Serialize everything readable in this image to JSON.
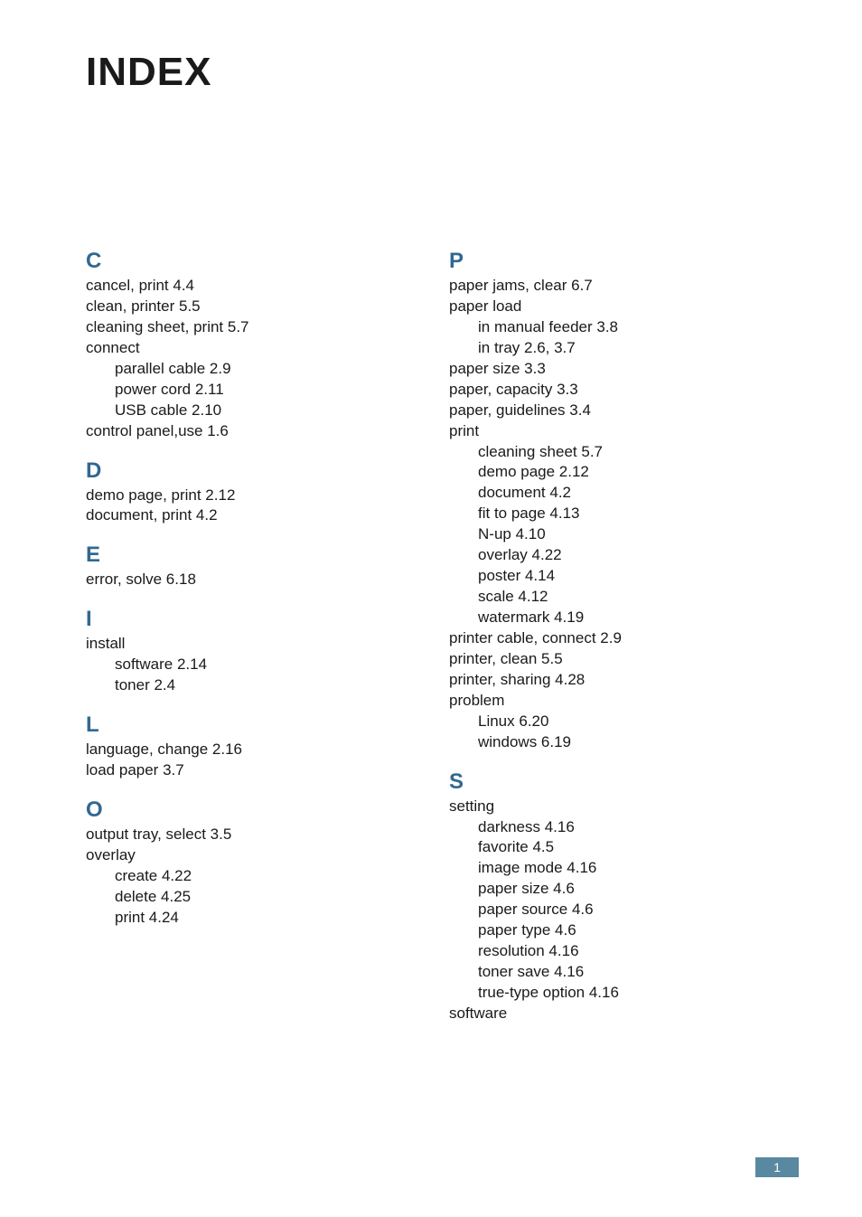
{
  "title": "INDEX",
  "page_number": "1",
  "left_column": [
    {
      "letter": "C",
      "entries": [
        {
          "text": "cancel, print 4.4",
          "sub": false,
          "interactable": true
        },
        {
          "text": "clean, printer 5.5",
          "sub": false,
          "interactable": true
        },
        {
          "text": "cleaning sheet, print 5.7",
          "sub": false,
          "interactable": true
        },
        {
          "text": "connect",
          "sub": false,
          "interactable": false
        },
        {
          "text": "parallel cable 2.9",
          "sub": true,
          "interactable": true
        },
        {
          "text": "power cord 2.11",
          "sub": true,
          "interactable": true
        },
        {
          "text": "USB cable 2.10",
          "sub": true,
          "interactable": true
        },
        {
          "text": "control panel,use 1.6",
          "sub": false,
          "interactable": true
        }
      ]
    },
    {
      "letter": "D",
      "entries": [
        {
          "text": "demo page, print 2.12",
          "sub": false,
          "interactable": true
        },
        {
          "text": "document, print 4.2",
          "sub": false,
          "interactable": true
        }
      ]
    },
    {
      "letter": "E",
      "entries": [
        {
          "text": "error, solve 6.18",
          "sub": false,
          "interactable": true
        }
      ]
    },
    {
      "letter": "I",
      "entries": [
        {
          "text": "install",
          "sub": false,
          "interactable": false
        },
        {
          "text": "software 2.14",
          "sub": true,
          "interactable": true
        },
        {
          "text": "toner 2.4",
          "sub": true,
          "interactable": true
        }
      ]
    },
    {
      "letter": "L",
      "entries": [
        {
          "text": "language, change 2.16",
          "sub": false,
          "interactable": true
        },
        {
          "text": "load paper 3.7",
          "sub": false,
          "interactable": true
        }
      ]
    },
    {
      "letter": "O",
      "entries": [
        {
          "text": "output tray, select 3.5",
          "sub": false,
          "interactable": true
        },
        {
          "text": "overlay",
          "sub": false,
          "interactable": false
        },
        {
          "text": "create 4.22",
          "sub": true,
          "interactable": true
        },
        {
          "text": "delete 4.25",
          "sub": true,
          "interactable": true
        },
        {
          "text": "print 4.24",
          "sub": true,
          "interactable": true
        }
      ]
    }
  ],
  "right_column": [
    {
      "letter": "P",
      "entries": [
        {
          "text": "paper jams, clear 6.7",
          "sub": false,
          "interactable": true
        },
        {
          "text": "paper load",
          "sub": false,
          "interactable": false
        },
        {
          "text": "in manual feeder 3.8",
          "sub": true,
          "interactable": true
        },
        {
          "text": "in tray 2.6, 3.7",
          "sub": true,
          "interactable": true
        },
        {
          "text": "paper size 3.3",
          "sub": false,
          "interactable": true
        },
        {
          "text": "paper, capacity 3.3",
          "sub": false,
          "interactable": true
        },
        {
          "text": "paper, guidelines 3.4",
          "sub": false,
          "interactable": true
        },
        {
          "text": "print",
          "sub": false,
          "interactable": false
        },
        {
          "text": "cleaning sheet 5.7",
          "sub": true,
          "interactable": true
        },
        {
          "text": "demo page 2.12",
          "sub": true,
          "interactable": true
        },
        {
          "text": "document 4.2",
          "sub": true,
          "interactable": true
        },
        {
          "text": "fit to page 4.13",
          "sub": true,
          "interactable": true
        },
        {
          "text": "N-up 4.10",
          "sub": true,
          "interactable": true
        },
        {
          "text": "overlay 4.22",
          "sub": true,
          "interactable": true
        },
        {
          "text": "poster 4.14",
          "sub": true,
          "interactable": true
        },
        {
          "text": "scale 4.12",
          "sub": true,
          "interactable": true
        },
        {
          "text": "watermark 4.19",
          "sub": true,
          "interactable": true
        },
        {
          "text": "printer cable, connect 2.9",
          "sub": false,
          "interactable": true
        },
        {
          "text": "printer, clean 5.5",
          "sub": false,
          "interactable": true
        },
        {
          "text": "printer, sharing 4.28",
          "sub": false,
          "interactable": true
        },
        {
          "text": "problem",
          "sub": false,
          "interactable": false
        },
        {
          "text": "Linux 6.20",
          "sub": true,
          "interactable": true
        },
        {
          "text": "windows 6.19",
          "sub": true,
          "interactable": true
        }
      ]
    },
    {
      "letter": "S",
      "entries": [
        {
          "text": "setting",
          "sub": false,
          "interactable": false
        },
        {
          "text": "darkness 4.16",
          "sub": true,
          "interactable": true
        },
        {
          "text": "favorite 4.5",
          "sub": true,
          "interactable": true
        },
        {
          "text": "image mode 4.16",
          "sub": true,
          "interactable": true
        },
        {
          "text": "paper size 4.6",
          "sub": true,
          "interactable": true
        },
        {
          "text": "paper source 4.6",
          "sub": true,
          "interactable": true
        },
        {
          "text": "paper type 4.6",
          "sub": true,
          "interactable": true
        },
        {
          "text": "resolution 4.16",
          "sub": true,
          "interactable": true
        },
        {
          "text": "toner save 4.16",
          "sub": true,
          "interactable": true
        },
        {
          "text": "true-type option 4.16",
          "sub": true,
          "interactable": true
        },
        {
          "text": "software",
          "sub": false,
          "interactable": false
        }
      ]
    }
  ]
}
